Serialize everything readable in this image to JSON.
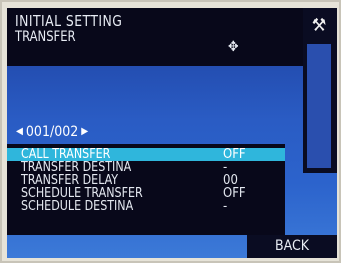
{
  "header": {
    "title": "INITIAL SETTING",
    "subtitle": "TRANSFER",
    "move_icon": "move-cross-icon",
    "tool_icon": "tools-icon",
    "tool_glyph": "⚒"
  },
  "pager": {
    "prev_glyph": "◀",
    "page": "001/002",
    "next_glyph": "▶"
  },
  "menu": {
    "items": [
      {
        "label": "CALL TRANSFER",
        "value": "OFF",
        "selected": true
      },
      {
        "label": "TRANSFER DESTINA",
        "value": "-",
        "selected": false
      },
      {
        "label": "TRANSFER DELAY",
        "value": "00",
        "selected": false
      },
      {
        "label": "SCHEDULE TRANSFER",
        "value": "OFF",
        "selected": false
      },
      {
        "label": "SCHEDULE DESTINA",
        "value": "-",
        "selected": false
      }
    ]
  },
  "footer": {
    "back_label": "BACK"
  },
  "colors": {
    "screen_blue": "#2a5cc4",
    "panel_dark": "#08081a",
    "highlight": "#2fb6dc"
  }
}
